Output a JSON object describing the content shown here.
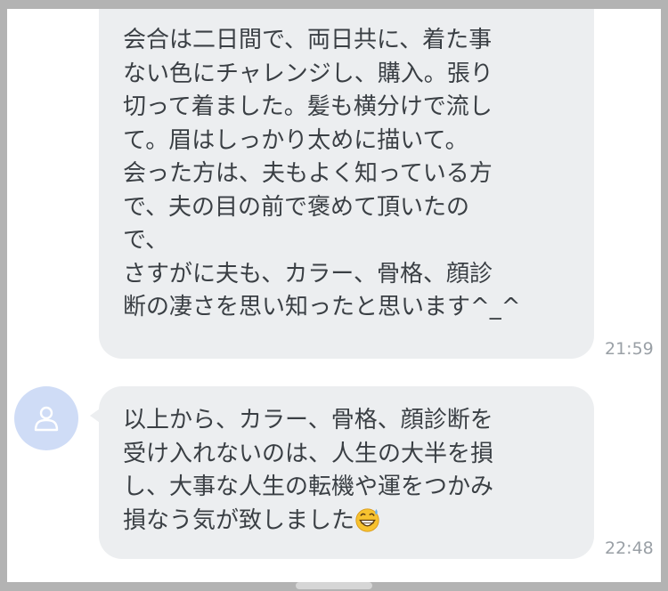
{
  "messages": [
    {
      "text": "会合は二日間で、両日共に、着た事\nない色にチャレンジし、購入。張り\n切って着ました。髪も横分けで流し\nて。眉はしっかり太めに描いて。\n会った方は、夫もよく知っている方\nで、夫の目の前で褒めて頂いたの\nで、\nさすがに夫も、カラー、骨格、顔診\n断の凄さを思い知ったと思います^_^",
      "time": "21:59"
    },
    {
      "text": "以上から、カラー、骨格、顔診断を\n受け入れないのは、人生の大半を損\nし、大事な人生の転機や運をつかみ\n損なう気が致しました",
      "emoji": "grinning-face-with-sweat-icon",
      "time": "22:48"
    }
  ],
  "avatar": {
    "icon": "person-outline-icon"
  },
  "colors": {
    "bubble": "#eceef0",
    "text": "#3a3f44",
    "timestamp": "#9aa0a6",
    "avatar_bg": "#cfdcf6",
    "outer_bg": "#b3b3b3"
  }
}
